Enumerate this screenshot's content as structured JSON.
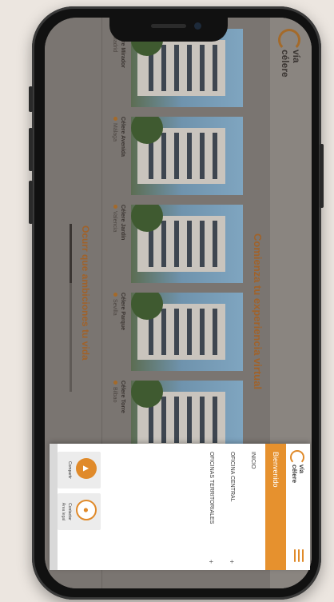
{
  "site": {
    "logo_line1": "vía",
    "logo_line2": "célere",
    "section_title": "Comienza tu experiencia virtual",
    "bottom_title": "Ocurr que ambiciones tu vida",
    "progress": 0.35,
    "cards": [
      {
        "name": "Célere Mirador",
        "location": "Madrid"
      },
      {
        "name": "Célere Avenida",
        "location": "Málaga"
      },
      {
        "name": "Célere Jardín",
        "location": "Valencia"
      },
      {
        "name": "Célere Parque",
        "location": "Sevilla"
      },
      {
        "name": "Célere Torre",
        "location": "Bilbao"
      }
    ]
  },
  "drawer": {
    "logo_line1": "vía",
    "logo_line2": "célere",
    "welcome": "Bienvenido",
    "items": [
      {
        "label": "INICIO",
        "expand": ""
      },
      {
        "label": "OFICINA CENTRAL",
        "expand": "+"
      },
      {
        "label": "OFICINAS TERRITORIALES",
        "expand": "+"
      }
    ],
    "quick_actions": [
      {
        "label": "Compartir",
        "sub": ""
      },
      {
        "label": "Contactar",
        "sub": "Área legal"
      }
    ]
  },
  "colors": {
    "accent": "#e08a2a",
    "overlay": "#6f6a66"
  }
}
